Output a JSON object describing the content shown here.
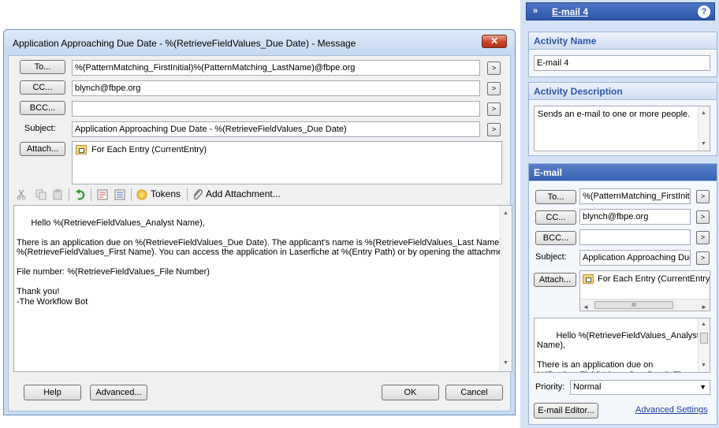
{
  "dialog": {
    "title": "Application Approaching Due Date - %(RetrieveFieldValues_Due Date) - Message",
    "close_glyph": "✕",
    "to_label": "To...",
    "to_value": "%(PatternMatching_FirstInitial)%(PatternMatching_LastName)@fbpe.org",
    "cc_label": "CC...",
    "cc_value": "blynch@fbpe.org",
    "bcc_label": "BCC...",
    "bcc_value": "",
    "subject_label": "Subject:",
    "subject_value": "Application Approaching Due Date - %(RetrieveFieldValues_Due Date)",
    "attach_label": "Attach...",
    "attachment": "For Each Entry (CurrentEntry)",
    "toolbar": {
      "tokens_label": "Tokens",
      "add_attachment_label": "Add Attachment..."
    },
    "body": "Hello %(RetrieveFieldValues_Analyst Name),\n\nThere is an application due on %(RetrieveFieldValues_Due Date). The applicant's name is %(RetrieveFieldValues_Last Name),\n%(RetrieveFieldValues_First Name). You can access the application in Laserfiche at %(Entry Path) or by opening the attachment.\n\nFile number: %(RetrieveFieldValues_File Number)\n\nThank you!\n-The Workflow Bot",
    "help_label": "Help",
    "advanced_label": "Advanced...",
    "ok_label": "OK",
    "cancel_label": "Cancel"
  },
  "panel": {
    "header_title": "E-mail 4",
    "activity_name_title": "Activity Name",
    "activity_name_value": "E-mail 4",
    "activity_description_title": "Activity Description",
    "activity_description_value": "Sends an e-mail to one or more people.",
    "email_title": "E-mail",
    "to_label": "To...",
    "to_value": "%(PatternMatching_FirstInitia",
    "cc_label": "CC...",
    "cc_value": "blynch@fbpe.org",
    "bcc_label": "BCC...",
    "bcc_value": "",
    "subject_label": "Subject:",
    "subject_value": "Application Approaching Due",
    "attach_label": "Attach...",
    "attachment": "For Each Entry (CurrentEntry)",
    "scroll_grip": "III",
    "body_preview": "Hello %(RetrieveFieldValues_Analyst\nName),\n\nThere is an application due on\n%(RetrieveFieldValues_Due Date). The",
    "priority_label": "Priority:",
    "priority_value": "Normal",
    "email_editor_label": "E-mail Editor...",
    "advanced_settings_label": "Advanced Settings"
  }
}
